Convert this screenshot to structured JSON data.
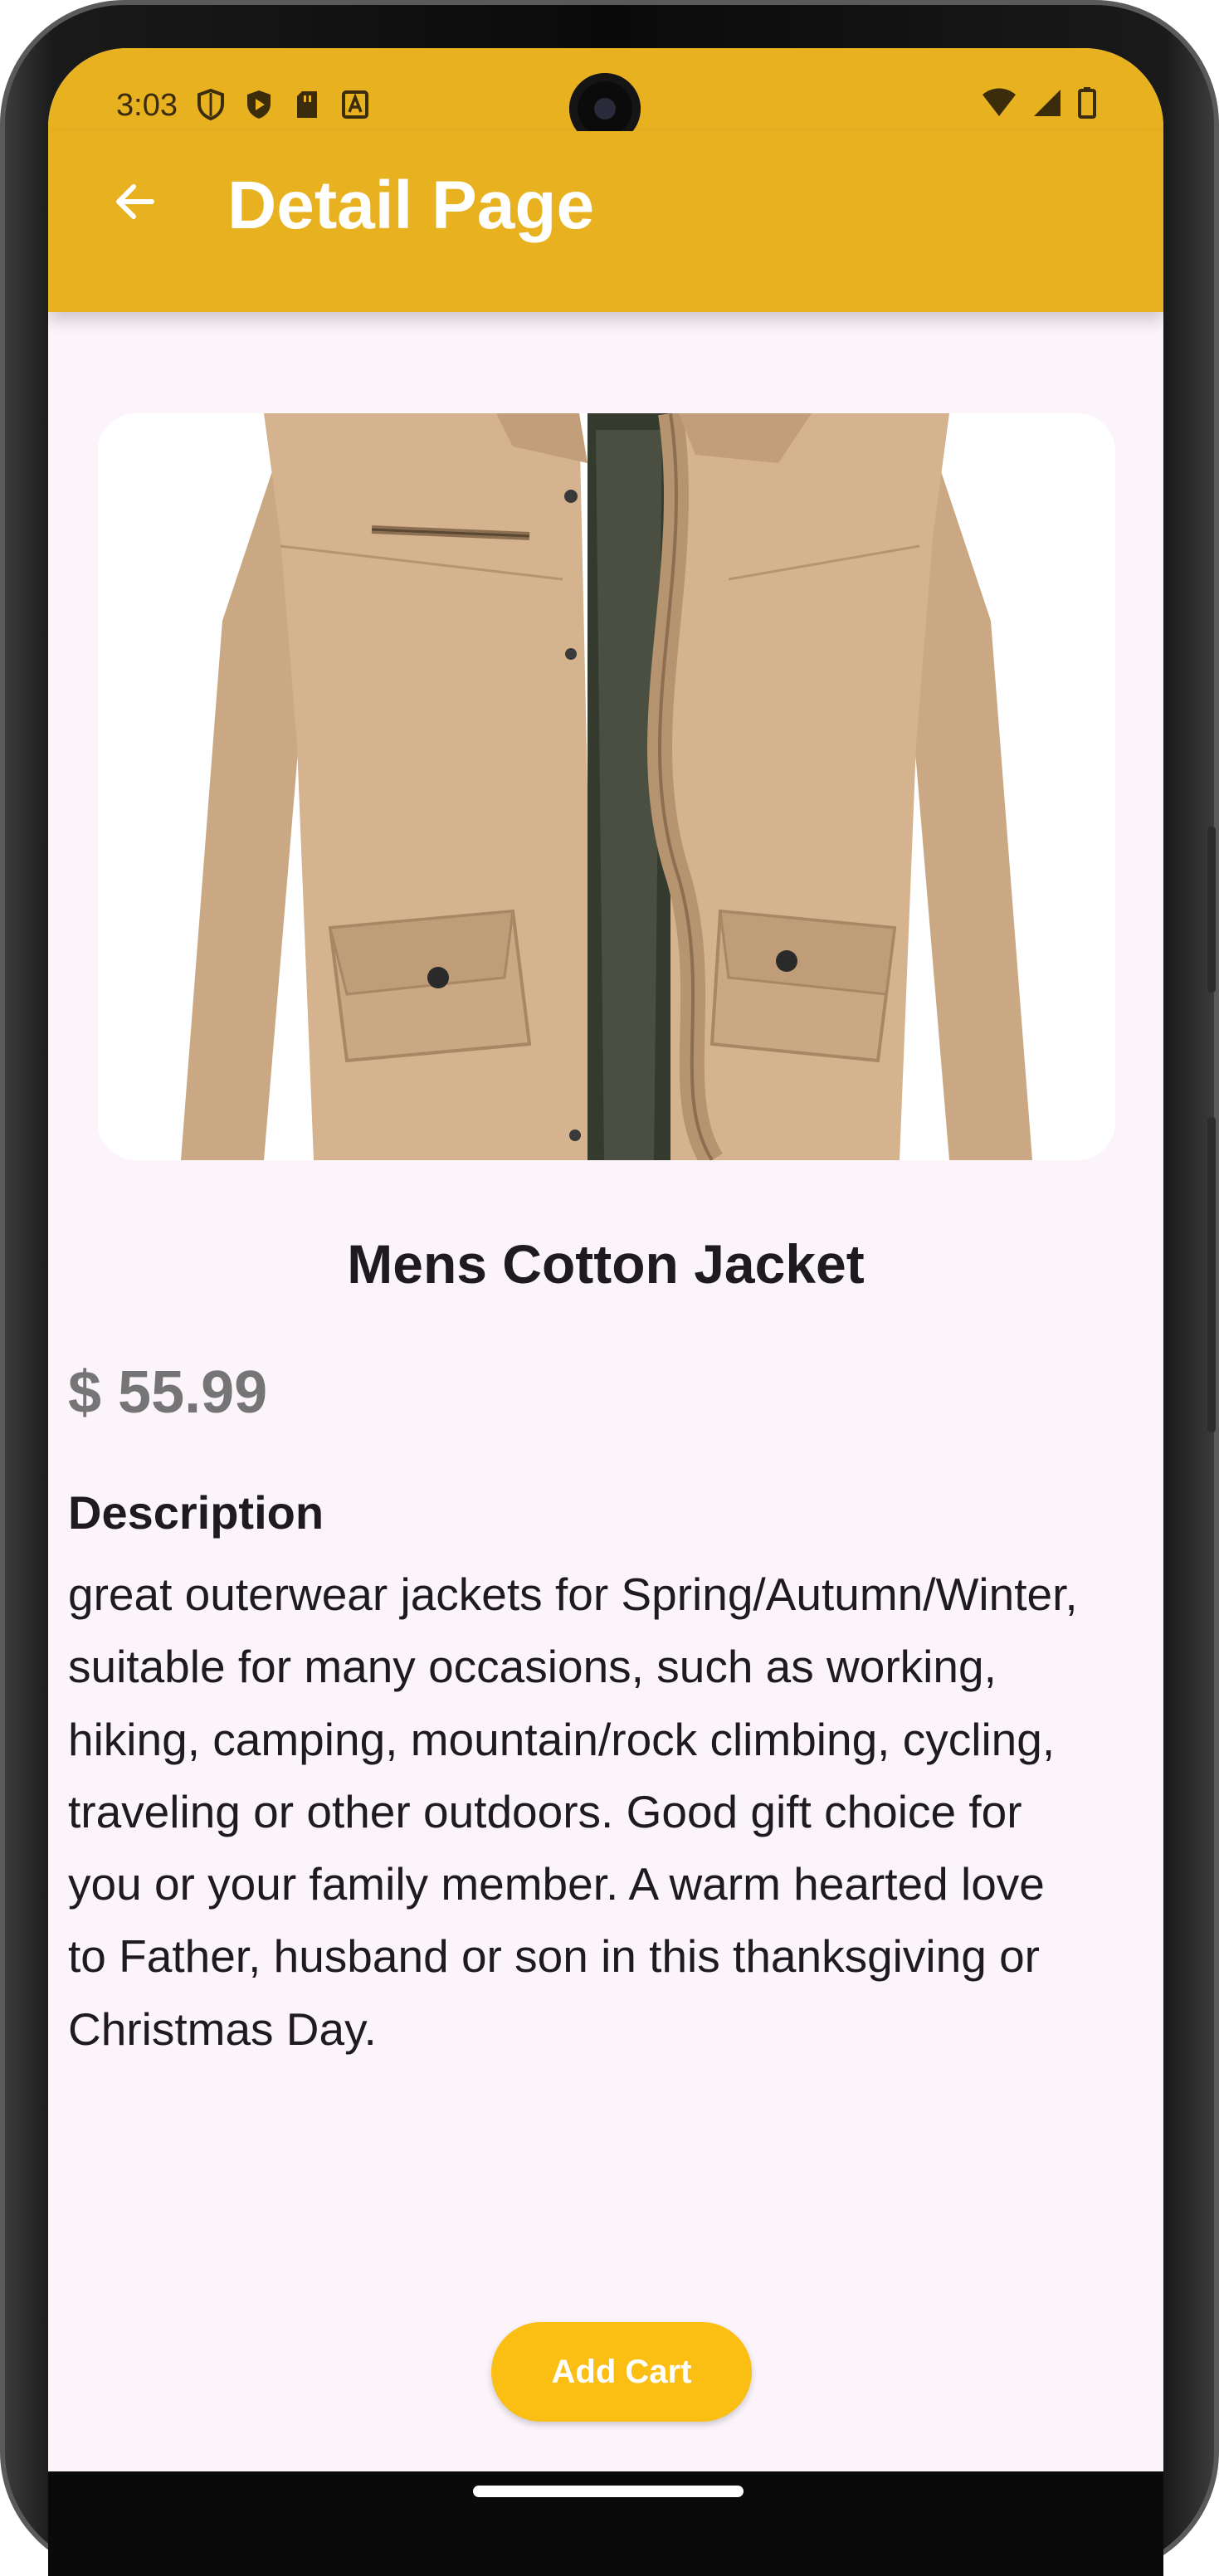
{
  "status_bar": {
    "time": "3:03",
    "left_icons": [
      "shield-icon",
      "play-protect-icon",
      "sd-card-icon",
      "font-a-icon"
    ],
    "right_icons": [
      "wifi-icon",
      "signal-icon",
      "battery-icon"
    ]
  },
  "app_bar": {
    "title": "Detail Page",
    "back_icon": "arrow-back-icon",
    "color": "#e8b11f"
  },
  "product": {
    "image": "jacket-image",
    "title": "Mens Cotton Jacket",
    "price": "$ 55.99",
    "description_heading": "Description",
    "description": "great outerwear jackets for Spring/Autumn/Winter, suitable for many occasions, such as working, hiking, camping, mountain/rock climbing, cycling, traveling or other outdoors. Good gift choice for you or your family member. A warm hearted love to Father, husband or son in this thanksgiving or Christmas Day."
  },
  "actions": {
    "add_cart_label": "Add Cart",
    "add_cart_color": "#fbbf14"
  },
  "theme": {
    "background": "#fbf4fb",
    "text_primary": "#1d1b20",
    "price_color": "#757575"
  }
}
